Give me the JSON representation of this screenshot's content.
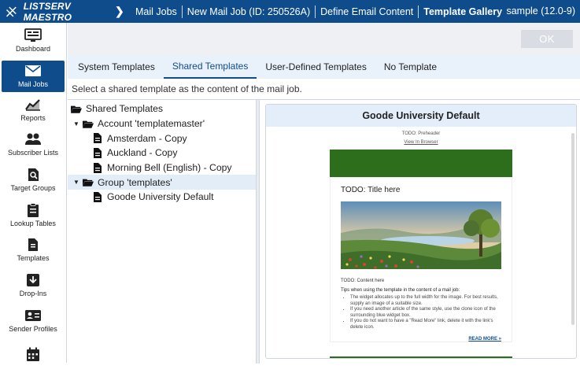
{
  "topbar": {
    "app_name": "LISTSERV MAESTRO",
    "breadcrumbs": [
      "Mail Jobs",
      "New Mail Job (ID: 250526A)",
      "Define Email Content",
      "Template Gallery"
    ],
    "user": "sample (12.0-9)"
  },
  "sidebar": {
    "items": [
      {
        "label": "Dashboard",
        "icon": "dashboard-icon"
      },
      {
        "label": "Mail Jobs",
        "icon": "mail-icon"
      },
      {
        "label": "Reports",
        "icon": "reports-icon"
      },
      {
        "label": "Subscriber Lists",
        "icon": "subscribers-icon"
      },
      {
        "label": "Target Groups",
        "icon": "target-groups-icon"
      },
      {
        "label": "Lookup Tables",
        "icon": "lookup-tables-icon"
      },
      {
        "label": "Templates",
        "icon": "templates-icon"
      },
      {
        "label": "Drop-Ins",
        "icon": "drop-ins-icon"
      },
      {
        "label": "Sender Profiles",
        "icon": "sender-profiles-icon"
      },
      {
        "label": "",
        "icon": "calendar-icon"
      }
    ]
  },
  "toolbar": {
    "ok_label": "OK"
  },
  "tabs": [
    "System Templates",
    "Shared Templates",
    "User-Defined Templates",
    "No Template"
  ],
  "description": "Select a shared template as the content of the mail job.",
  "tree": {
    "root": "Shared Templates",
    "account": "Account 'templatemaster'",
    "account_items": [
      "Amsterdam - Copy",
      "Auckland - Copy",
      "Morning Bell (English) - Copy"
    ],
    "group": "Group 'templates'",
    "group_items": [
      "Goode University Default"
    ]
  },
  "preview": {
    "title": "Goode University Default",
    "preheader": "TODO: Preheader",
    "view_in_browser": "View In Browser",
    "content_title": "TODO: Title here",
    "content_text": "TODO: Content here",
    "tips_heading": "Tips when using the template in the content of a mail job:",
    "tips": [
      "The widget allocates up to the full width for the image. For best results, supply an image of a suitable size.",
      "If you need another article of the same style, use the clone icon of the surrounding blue widget box.",
      "If you do not want to have a \"Read More\" link, delete it with the link's delete icon."
    ],
    "read_more": "READ MORE »",
    "colors": {
      "banner": "#2c6e1c",
      "accent": "#0f4c8c"
    }
  }
}
